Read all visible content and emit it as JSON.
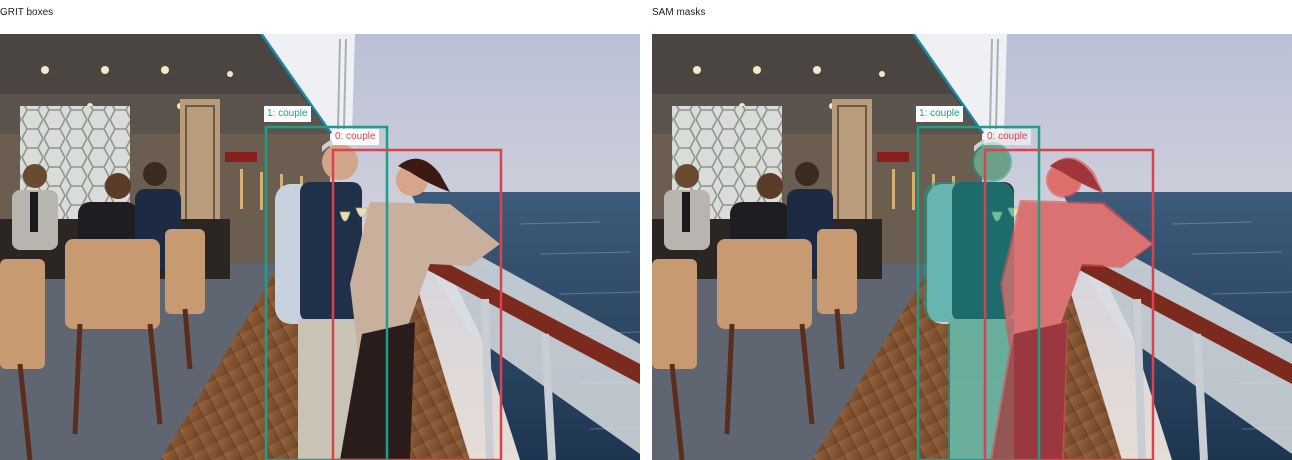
{
  "panels": {
    "left": {
      "title": "GRIT boxes"
    },
    "right": {
      "title": "SAM masks"
    }
  },
  "detections": [
    {
      "id": 0,
      "label": "0: couple",
      "color": "#d9434b"
    },
    {
      "id": 1,
      "label": "1: couple",
      "color": "#1b9e8a"
    }
  ],
  "icons": {
    "photo": "cruise-deck-couple-photo"
  }
}
